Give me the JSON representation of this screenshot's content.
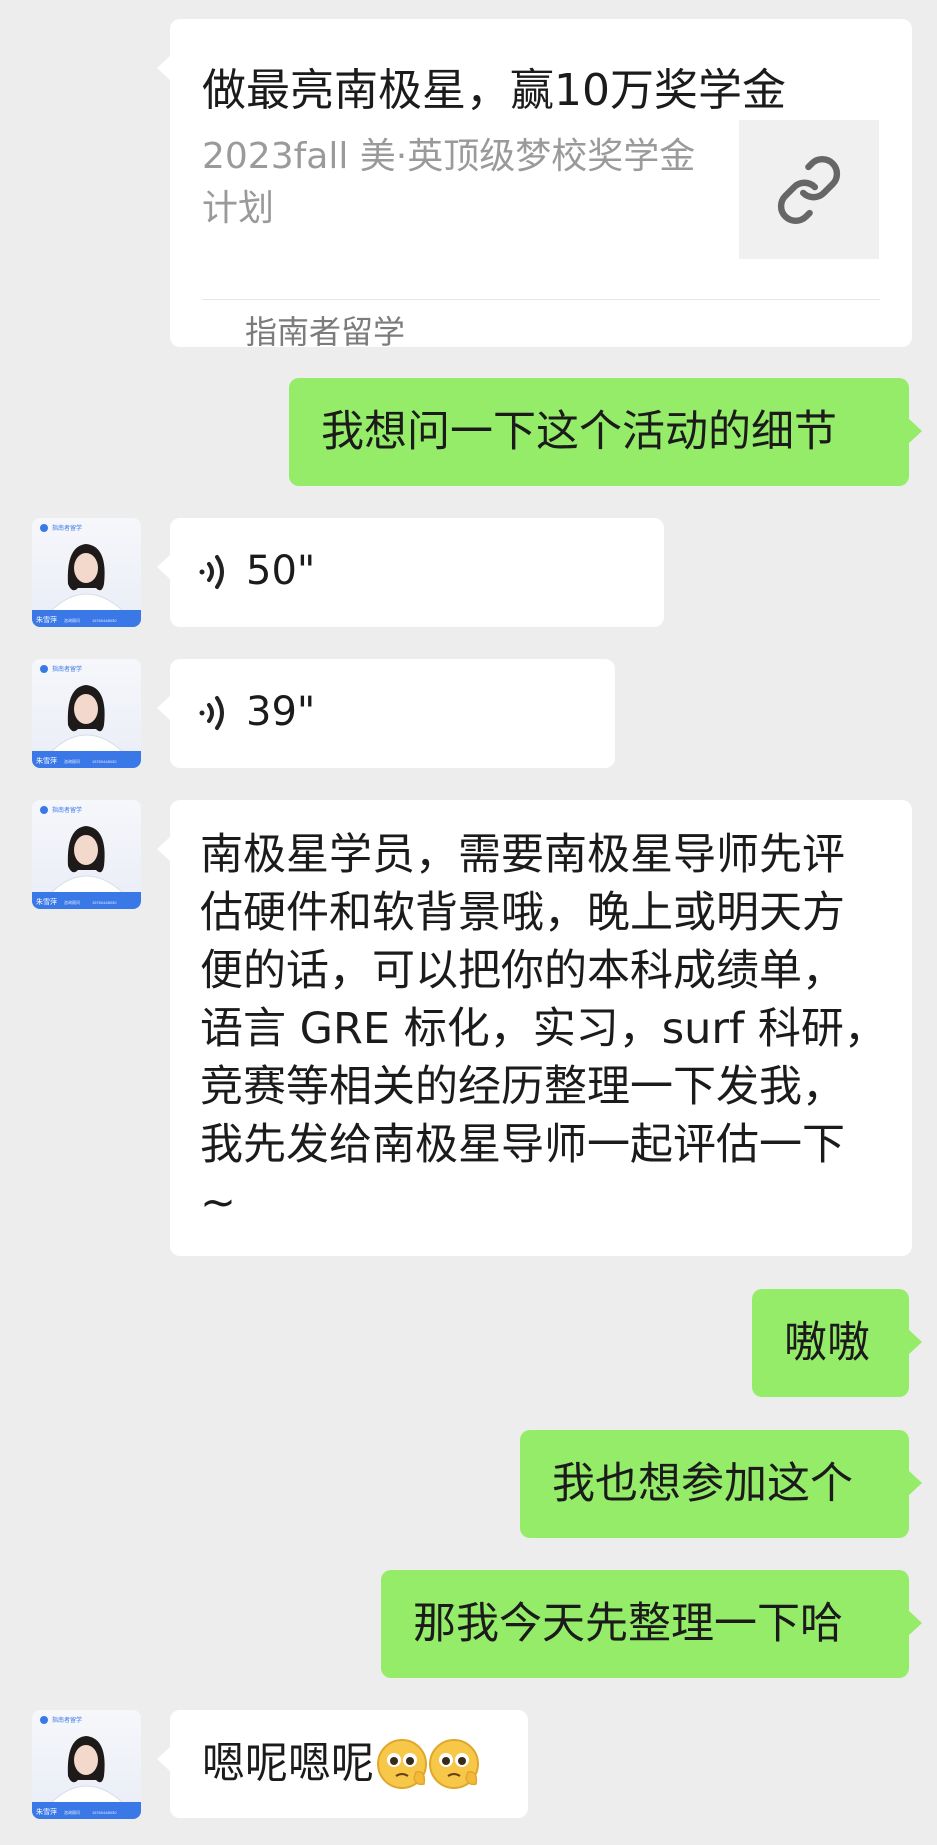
{
  "messages": [
    {
      "type": "link_card",
      "title": "做最亮南极星，赢10万奖学金",
      "description": "2023fall 美·英顶级梦校奖学金计划",
      "source": "指南者留学",
      "thumbnail_icon": "link-icon"
    },
    {
      "type": "text",
      "side": "out",
      "text": "我想问一下这个活动的细节"
    },
    {
      "type": "voice",
      "side": "in",
      "duration": "50\"",
      "avatar": {
        "logo_text": "指南者留学",
        "name": "朱雪萍",
        "title": "咨询顾问",
        "phone": "15760448030"
      }
    },
    {
      "type": "voice",
      "side": "in",
      "duration": "39\"",
      "avatar": {
        "logo_text": "指南者留学",
        "name": "朱雪萍",
        "title": "咨询顾问",
        "phone": "15760448030"
      }
    },
    {
      "type": "text",
      "side": "in",
      "lines": [
        "南极星学员，需要南极星导师先评",
        "估硬件和软背景哦，晚上或明天方",
        "便的话，可以把你的本科成绩单，",
        "语言 GRE 标化，实习，surf 科研，",
        "竞赛等相关的经历整理一下发我，",
        "我先发给南极星导师一起评估一下",
        "~"
      ],
      "avatar": {
        "logo_text": "指南者留学",
        "name": "朱雪萍",
        "title": "咨询顾问",
        "phone": "15760448030"
      }
    },
    {
      "type": "text",
      "side": "out",
      "text": "嗷嗷"
    },
    {
      "type": "text",
      "side": "out",
      "text": "我也想参加这个"
    },
    {
      "type": "text",
      "side": "out",
      "text": "那我今天先整理一下哈"
    },
    {
      "type": "text",
      "side": "in",
      "text": "嗯呢嗯呢",
      "emoji": "pleading-face-emoji",
      "avatar": {
        "logo_text": "指南者留学",
        "name": "朱雪萍",
        "title": "咨询顾问",
        "phone": "15760448030"
      }
    }
  ],
  "colors": {
    "background": "#ededed",
    "incoming_bubble": "#ffffff",
    "outgoing_bubble": "#95ec69",
    "avatar_banner": "#3b78e7"
  }
}
